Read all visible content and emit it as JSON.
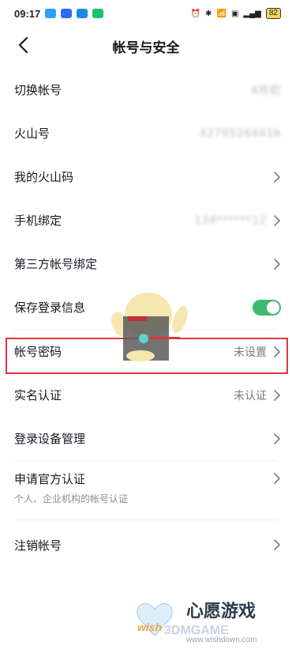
{
  "status_bar": {
    "time": "09:17",
    "battery": "82"
  },
  "header": {
    "title": "帐号与安全"
  },
  "rows": [
    {
      "label": "切换帐号",
      "value": "4月初"
    },
    {
      "label": "火山号",
      "value": "4279526441b"
    },
    {
      "label": "我的火山码"
    },
    {
      "label": "手机绑定",
      "value": "134******12"
    },
    {
      "label": "第三方帐号绑定"
    },
    {
      "label": "保存登录信息"
    },
    {
      "label": "帐号密码",
      "value": "未设置"
    },
    {
      "label": "实名认证",
      "value": "未认证"
    },
    {
      "label": "登录设备管理"
    },
    {
      "label": "申请官方认证",
      "sub": "个人、企业机构的帐号认证"
    },
    {
      "label": "注销帐号"
    }
  ],
  "toggle": {
    "save_login_enabled": true
  },
  "watermark": {
    "text": "心愿游戏",
    "brand": "wish 3DMGAME",
    "url": "www.wishdown.com"
  },
  "colors": {
    "accent_green": "#3cbb6e",
    "highlight_red": "#e0363f"
  }
}
